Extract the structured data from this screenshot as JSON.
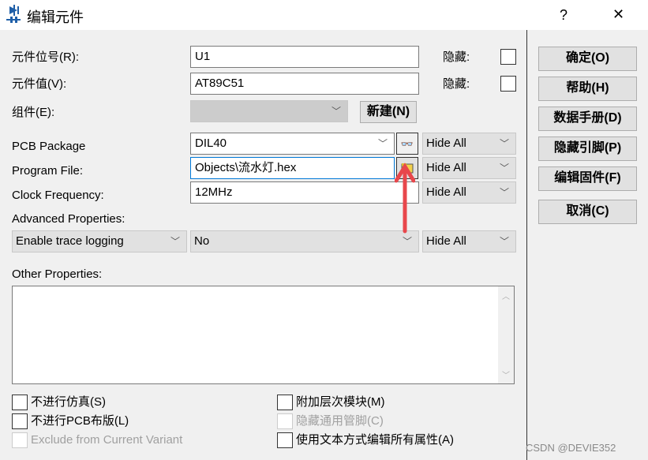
{
  "window": {
    "title": "编辑元件",
    "help": "?",
    "close": "✕"
  },
  "fields": {
    "ref_label": "元件位号(R):",
    "ref_value": "U1",
    "value_label": "元件值(V):",
    "value_value": "AT89C51",
    "group_label": "组件(E):",
    "new_button": "新建(N)",
    "hidden_label": "隐藏:",
    "pcb_label": "PCB Package",
    "pcb_value": "DIL40",
    "program_label": "Program File:",
    "program_value": "Objects\\流水灯.hex",
    "clock_label": "Clock Frequency:",
    "clock_value": "12MHz",
    "hide_all": "Hide All",
    "advanced_label": "Advanced Properties:",
    "advanced_prop": "Enable trace logging",
    "advanced_value": "No",
    "other_label": "Other Properties:"
  },
  "buttons": [
    "确定(O)",
    "帮助(H)",
    "数据手册(D)",
    "隐藏引脚(P)",
    "编辑固件(F)",
    "取消(C)"
  ],
  "checkboxes": {
    "no_sim": "不进行仿真(S)",
    "no_pcb": "不进行PCB布版(L)",
    "exclude_variant": "Exclude from Current Variant",
    "attach_module": "附加层次模块(M)",
    "hide_common_pins": "隐藏通用管脚(C)",
    "edit_text": "使用文本方式编辑所有属性(A)"
  },
  "watermark": "CSDN @DEVIE352",
  "colors": {
    "annotation_arrow": "#e8474c",
    "focus_border": "#0078d7"
  }
}
